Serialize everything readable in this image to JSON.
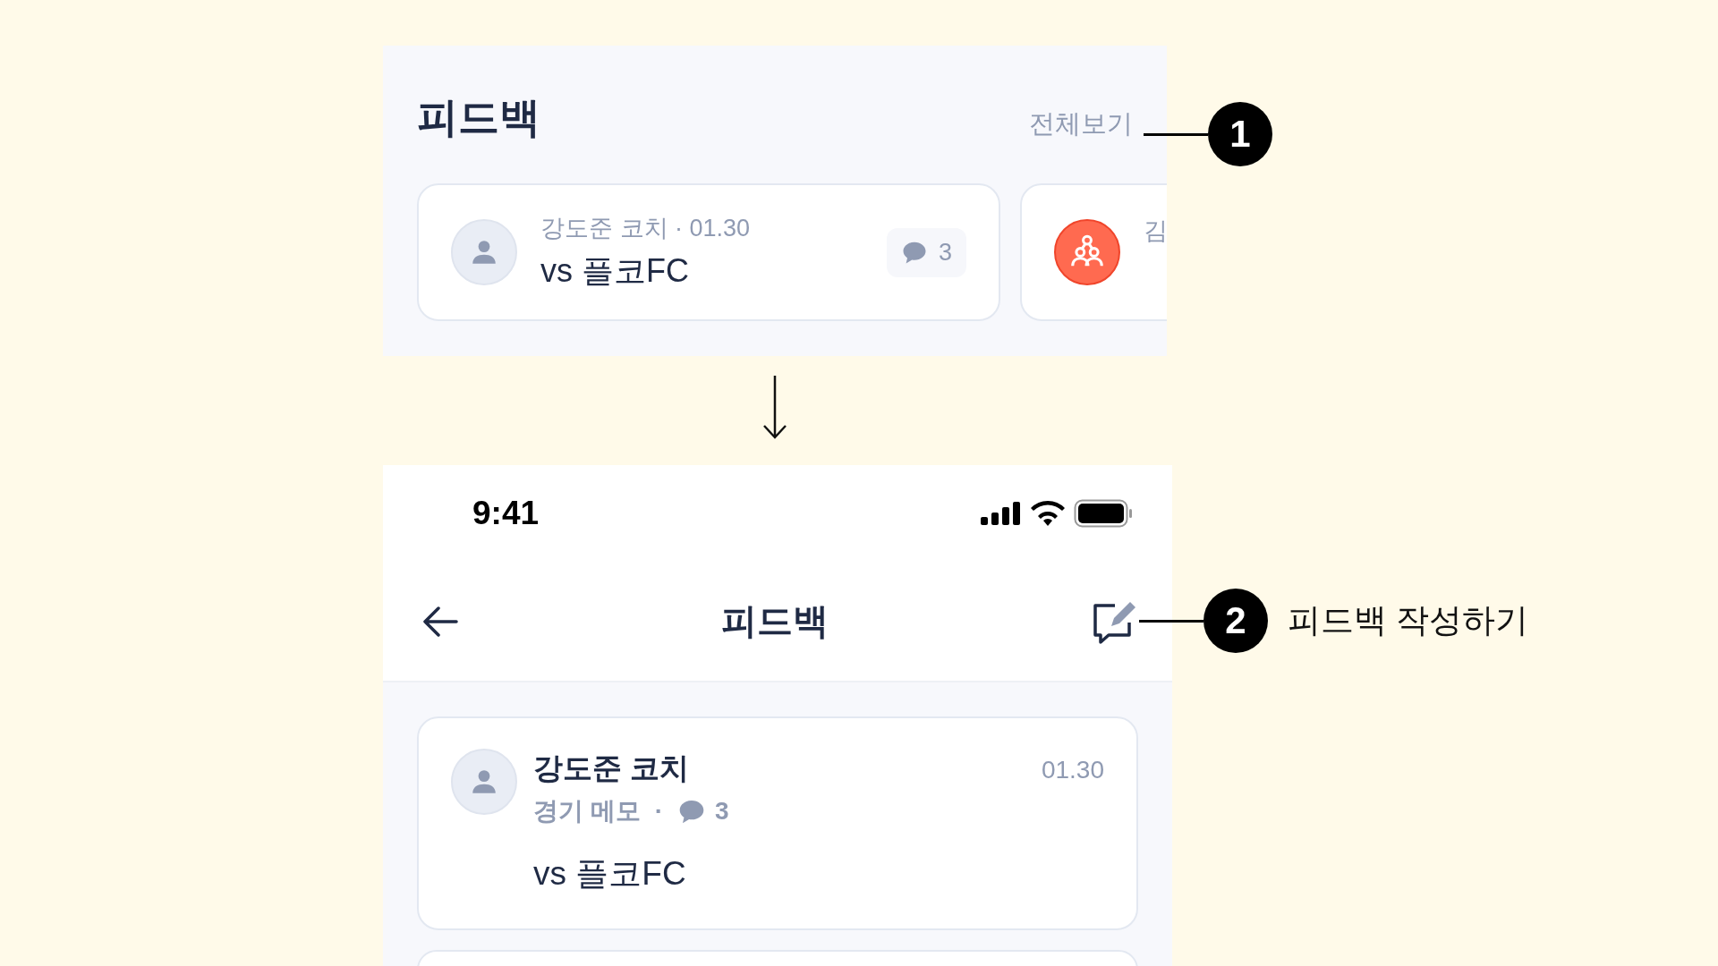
{
  "preview": {
    "title": "피드백",
    "view_all": "전체보기",
    "cards": [
      {
        "kind": "person",
        "meta": "강도준 코치 · 01.30",
        "title": "vs 플코FC",
        "comments": "3"
      },
      {
        "kind": "group",
        "meta": "김"
      }
    ]
  },
  "screen": {
    "status_bar": {
      "time": "9:41"
    },
    "nav": {
      "title": "피드백"
    },
    "feedback_list": [
      {
        "author": "강도준 코치",
        "category": "경기 메모",
        "separator": "·",
        "comments": "3",
        "date": "01.30",
        "title": "vs 플코FC"
      }
    ]
  },
  "callouts": [
    {
      "number": "1"
    },
    {
      "number": "2",
      "label": "피드백 작성하기"
    }
  ]
}
